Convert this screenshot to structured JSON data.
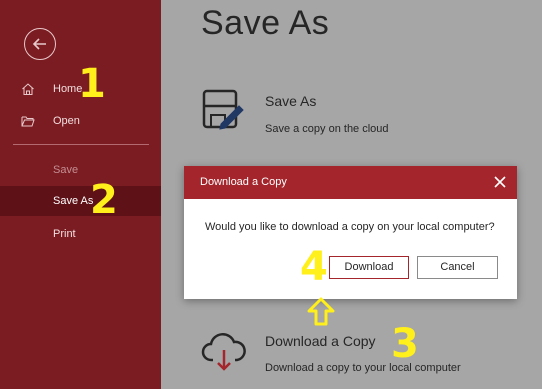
{
  "sidebar": {
    "items": [
      {
        "label": "Home",
        "icon": "home-icon"
      },
      {
        "label": "Open",
        "icon": "folder-open-icon"
      },
      {
        "label": "Save"
      },
      {
        "label": "Save As"
      },
      {
        "label": "Print"
      }
    ]
  },
  "main": {
    "title": "Save As",
    "options": [
      {
        "title": "Save As",
        "description": "Save a copy on the cloud",
        "icon": "save-as-icon"
      },
      {
        "title": "Download a Copy",
        "description": "Download a copy to your local computer",
        "icon": "cloud-download-icon"
      }
    ]
  },
  "dialog": {
    "title": "Download a Copy",
    "message": "Would you like to download a copy on your local computer?",
    "download_label": "Download",
    "cancel_label": "Cancel"
  },
  "annotations": {
    "step1": "1",
    "step2": "2",
    "step3": "3",
    "step4": "4"
  },
  "colors": {
    "sidebar_bg": "#7b1c22",
    "sidebar_active_bg": "#5e1217",
    "accent": "#a4262c",
    "annotation": "#ffef1a"
  }
}
